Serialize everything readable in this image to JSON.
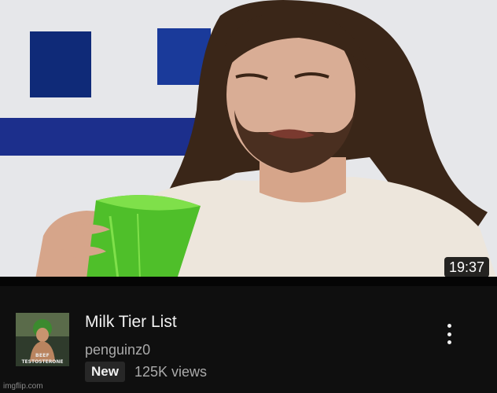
{
  "video": {
    "duration": "19:37",
    "title": "Milk Tier List",
    "channel": "penguinz0",
    "badge": "New",
    "views": "125K views"
  },
  "channel_avatar": {
    "line1": "BEEF",
    "line2": "TESTOSTERONE"
  },
  "watermark": "imgflip.com",
  "colors": {
    "background": "#0f0f0f",
    "title_text": "#f1f1f1",
    "secondary_text": "#aaaaaa",
    "badge_bg": "#272727",
    "cup_green": "#4fbf2a"
  },
  "icons": {
    "more": "vertical-ellipsis-icon"
  }
}
